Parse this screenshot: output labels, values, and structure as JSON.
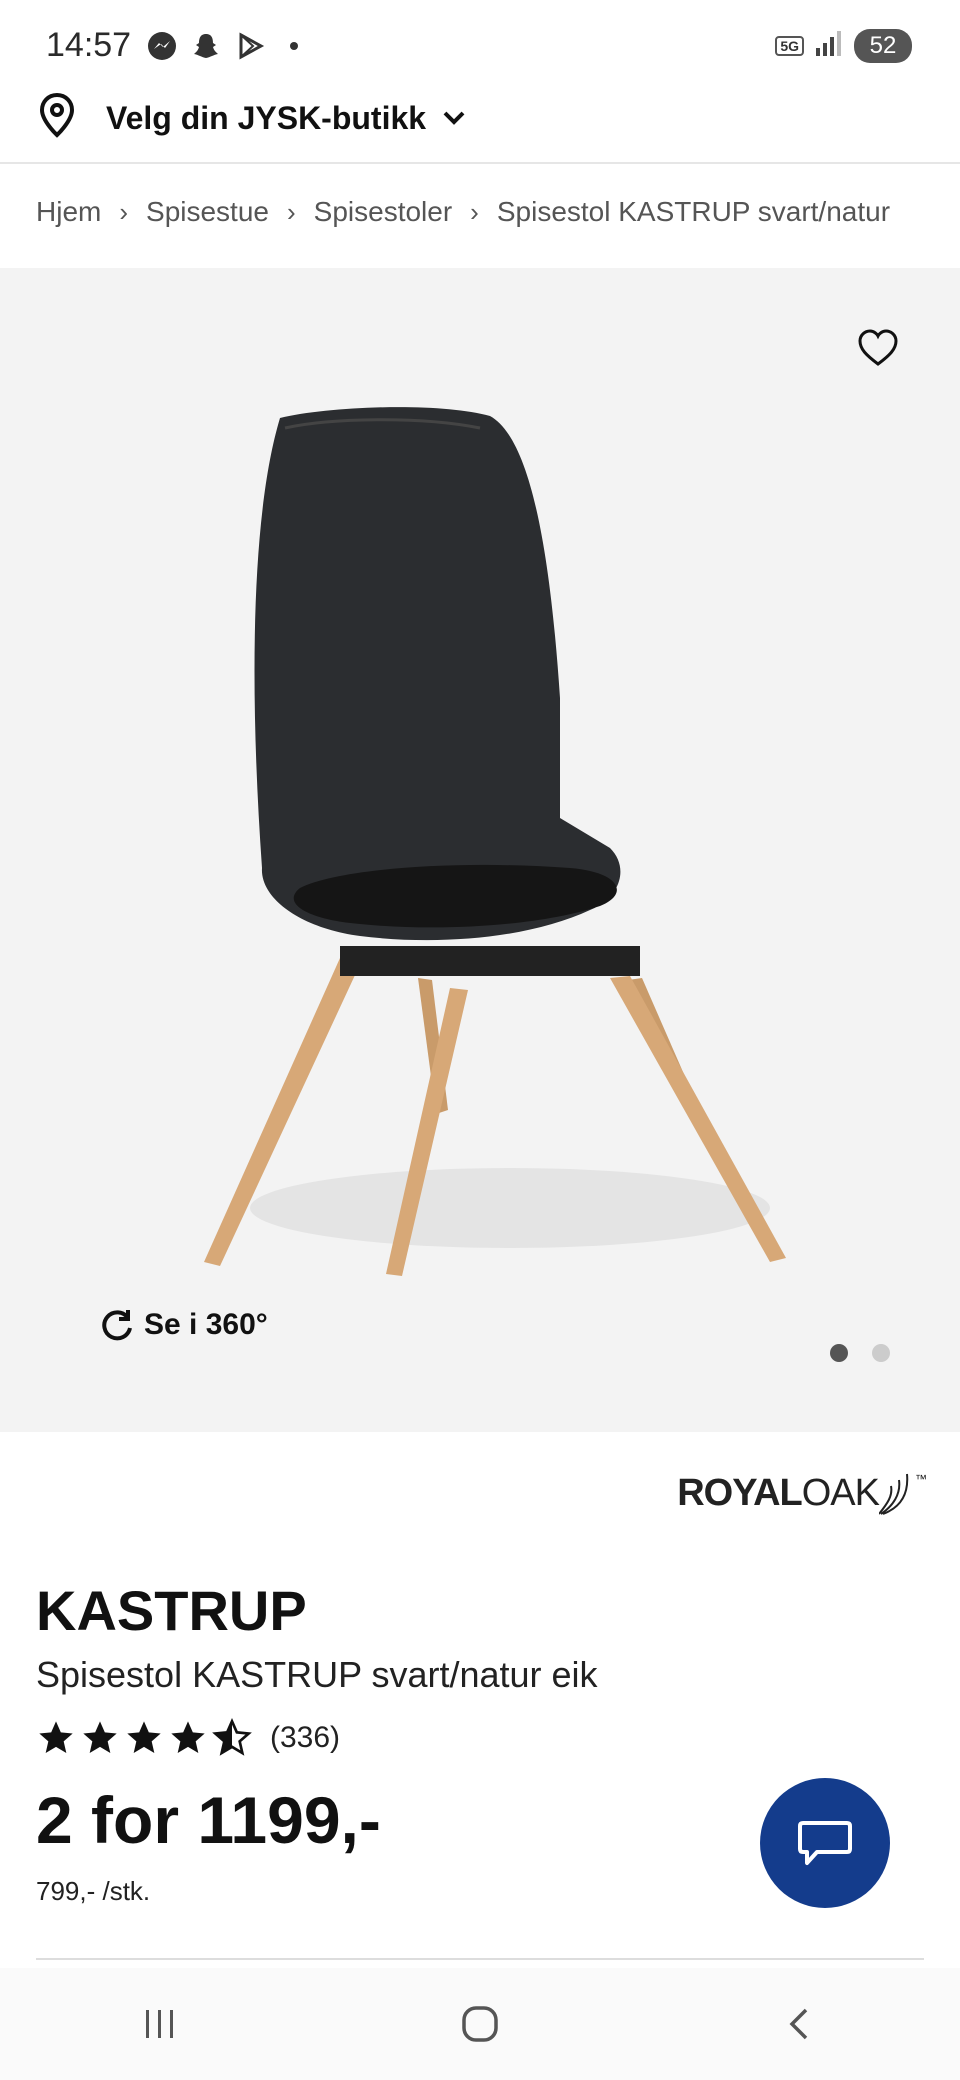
{
  "status": {
    "time": "14:57",
    "network": "5G",
    "battery": "52"
  },
  "store": {
    "label": "Velg din JYSK-butikk"
  },
  "breadcrumb": [
    "Hjem",
    "Spisestue",
    "Spisestoler",
    "Spisestol KASTRUP svart/natur"
  ],
  "gallery": {
    "se360_label": "Se i 360°",
    "slides": 2,
    "active_slide": 1
  },
  "brand": {
    "part1": "ROYAL",
    "part2": "OAK",
    "tm": "™"
  },
  "product": {
    "title": "KASTRUP",
    "subtitle": "Spisestol KASTRUP svart/natur eik",
    "rating": 4.5,
    "review_count": "(336)",
    "price_offer": "2 for 1199,-",
    "price_unit": "799,- /stk."
  },
  "colors": {
    "accent": "#143c8c",
    "gallery_bg": "#f3f3f3"
  }
}
